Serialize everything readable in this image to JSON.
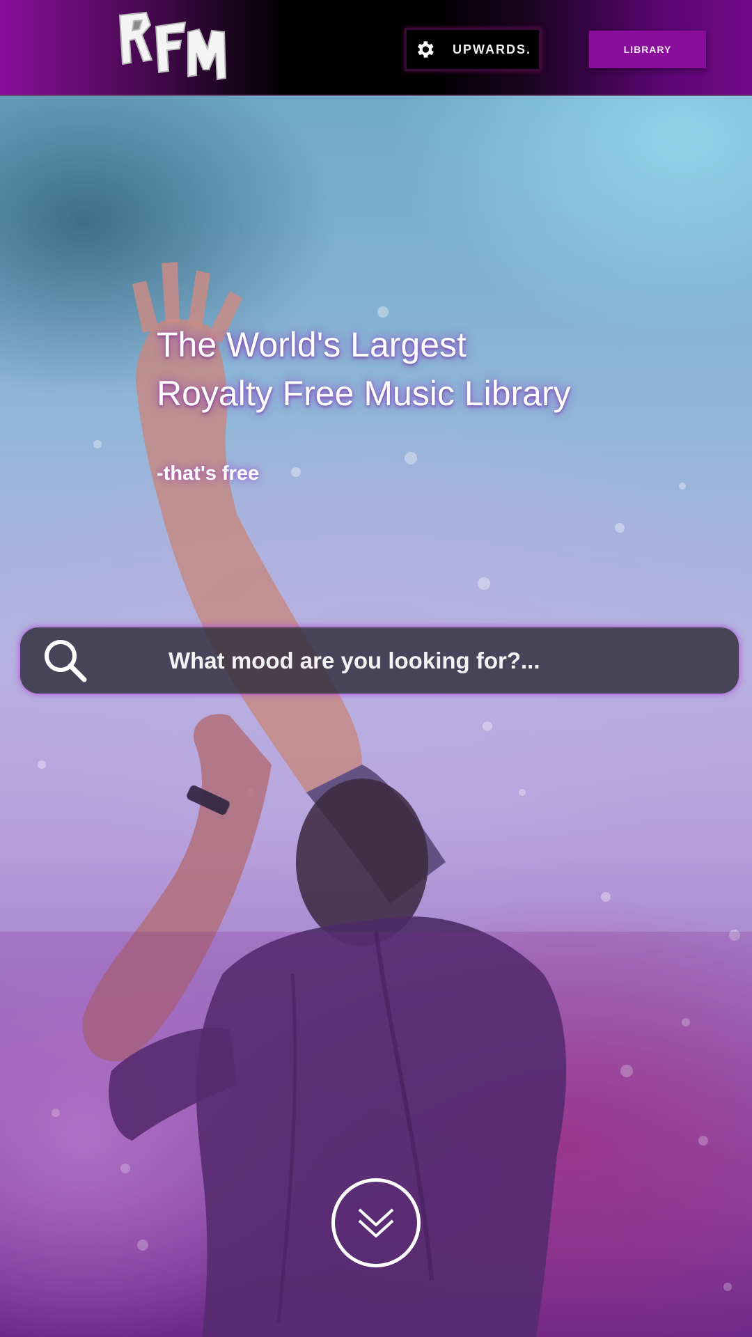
{
  "header": {
    "logo_text": "RFM",
    "settings_label": "UPWARDS.",
    "library_label": "LIBRARY"
  },
  "hero": {
    "headline_line1": "The World's Largest",
    "headline_line2": "Royalty Free Music Library",
    "tagline": "-that's free"
  },
  "search": {
    "placeholder": "What mood are you looking for?..."
  },
  "icons": {
    "settings": "gear-icon",
    "search": "search-icon",
    "scroll": "double-chevron-down-icon"
  },
  "colors": {
    "brand_purple": "#8a0d9c",
    "header_dark": "#000000",
    "search_glow": "#af3cdc"
  }
}
